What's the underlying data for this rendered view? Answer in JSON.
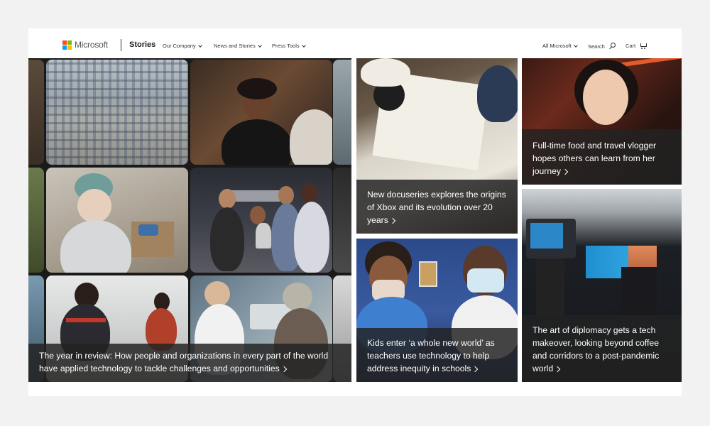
{
  "header": {
    "logo_text": "Microsoft",
    "brand": "Stories",
    "nav": [
      {
        "label": "Our Company"
      },
      {
        "label": "News and Stories"
      },
      {
        "label": "Press Tools"
      }
    ],
    "all_microsoft": "All Microsoft",
    "search": "Search",
    "cart": "Cart"
  },
  "colors": {
    "logo_red": "#f25022",
    "logo_green": "#7fba00",
    "logo_blue": "#00a4ef",
    "logo_yellow": "#ffb900",
    "caption_bg": "#222222"
  },
  "tiles": [
    {
      "caption": "The year in review: How people and organizations in every part of the world have applied technology to tackle challenges and opportunities"
    },
    {
      "caption": "New docuseries explores the origins of Xbox and its evolution over 20 years"
    },
    {
      "caption": "Full-time food and travel vlogger hopes others can learn from her journey"
    },
    {
      "caption": "Kids enter ‘a whole new world’ as teachers use technology to help address inequity in schools"
    },
    {
      "caption": "The art of diplomacy gets a tech makeover, looking beyond coffee and corridors to a post-pandemic world"
    }
  ]
}
